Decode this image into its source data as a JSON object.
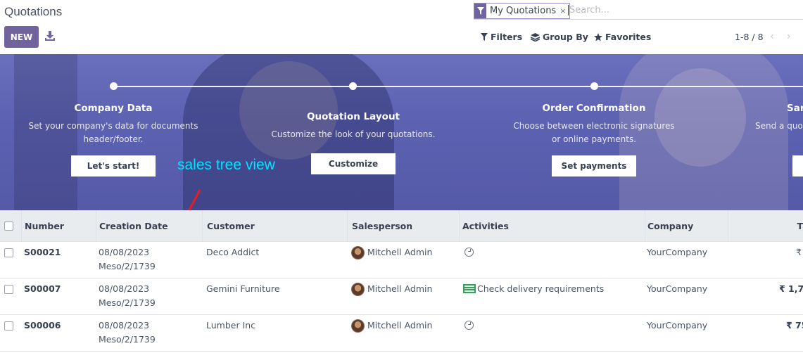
{
  "header": {
    "title": "Quotations",
    "new_label": "NEW",
    "download_icon": "download-icon"
  },
  "search": {
    "facet_icon": "filter-icon",
    "facet_label": "My Quotations",
    "facet_remove": "×",
    "placeholder": "Search..."
  },
  "toolbar": {
    "filters_label": "Filters",
    "groupby_label": "Group By",
    "favorites_label": "Favorites",
    "pager": "1-8 / 8",
    "prev": "‹",
    "next": "›"
  },
  "banner": {
    "steps": [
      {
        "title": "Company Data",
        "desc1": "Set your company's data for documents",
        "desc2": "header/footer.",
        "button": "Let's start!"
      },
      {
        "title": "Quotation Layout",
        "desc1": "Customize the look of your quotations.",
        "desc2": "",
        "button": "Customize"
      },
      {
        "title": "Order Confirmation",
        "desc1": "Choose between electronic signatures",
        "desc2": "or online payments.",
        "button": "Set payments"
      },
      {
        "title": "Sam",
        "desc1": "Send a quot",
        "desc2": "",
        "button": ""
      }
    ]
  },
  "annotation": {
    "text": "sales tree view",
    "color": "#00e5ff"
  },
  "table": {
    "columns": [
      "Number",
      "Creation Date",
      "Customer",
      "Salesperson",
      "Activities",
      "Company",
      "T"
    ],
    "rows": [
      {
        "number": "S00021",
        "date": "08/08/2023",
        "date2": "Meso/2/1739",
        "customer": "Deco Addict",
        "salesperson": "Mitchell Admin",
        "activity_icon": "clock-icon",
        "activity": "",
        "company": "YourCompany",
        "total": "₹"
      },
      {
        "number": "S00007",
        "date": "08/08/2023",
        "date2": "Meso/2/1739",
        "customer": "Gemini Furniture",
        "salesperson": "Mitchell Admin",
        "activity_icon": "todo-icon",
        "activity": "Check delivery requirements",
        "company": "YourCompany",
        "total": "₹ 1,70"
      },
      {
        "number": "S00006",
        "date": "08/08/2023",
        "date2": "Meso/2/1739",
        "customer": "Lumber Inc",
        "salesperson": "Mitchell Admin",
        "activity_icon": "clock-icon",
        "activity": "",
        "company": "YourCompany",
        "total": "₹ 75"
      }
    ]
  },
  "colors": {
    "brand": "#71639e",
    "banner": "#5d62b2",
    "header_bg": "#e9ecef"
  }
}
